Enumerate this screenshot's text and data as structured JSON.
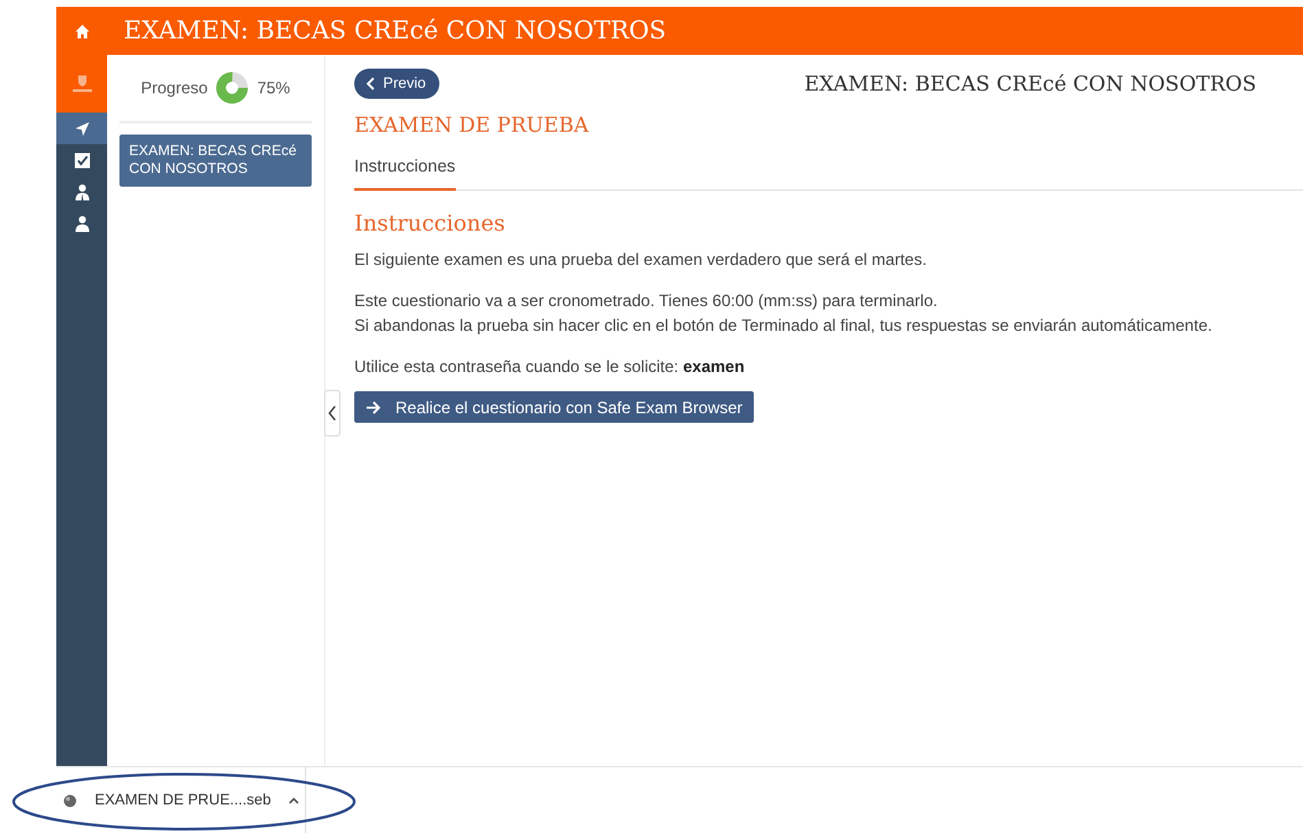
{
  "header": {
    "title": "EXAMEN: BECAS CREcé CON NOSOTROS"
  },
  "rail": {
    "items": [
      {
        "kind": "navigate",
        "selected": true
      },
      {
        "kind": "check",
        "selected": false
      },
      {
        "kind": "group",
        "selected": false
      },
      {
        "kind": "person",
        "selected": false
      }
    ]
  },
  "sidebar": {
    "progress_label": "Progreso",
    "progress_text": "75%",
    "items": [
      {
        "label": "EXAMEN: BECAS CREcé CON NOSOTROS",
        "selected": true
      }
    ]
  },
  "main": {
    "back_button": "Previo",
    "course_title": "EXAMEN: BECAS CREcé CON NOSOTROS",
    "exam_title": "EXAMEN DE PRUEBA",
    "tabs": [
      {
        "label": "Instrucciones",
        "selected": true
      }
    ],
    "section_title": "Instrucciones",
    "paragraphs": [
      [
        "El siguiente examen es una prueba del examen verdadero que será el martes."
      ],
      [
        "Este cuestionario va a ser cronometrado. Tienes 60:00 (mm:ss) para terminarlo.",
        "Si abandonas la prueba sin hacer clic en el botón de Terminado al final, tus respuestas se enviarán automáticamente."
      ],
      [
        "Utilice esta contraseña cuando se le solicite: **examen**"
      ]
    ],
    "start_button": "Realice el cuestionario con Safe Exam Browser"
  },
  "download_bar": {
    "file": "EXAMEN DE PRUE....seb"
  }
}
